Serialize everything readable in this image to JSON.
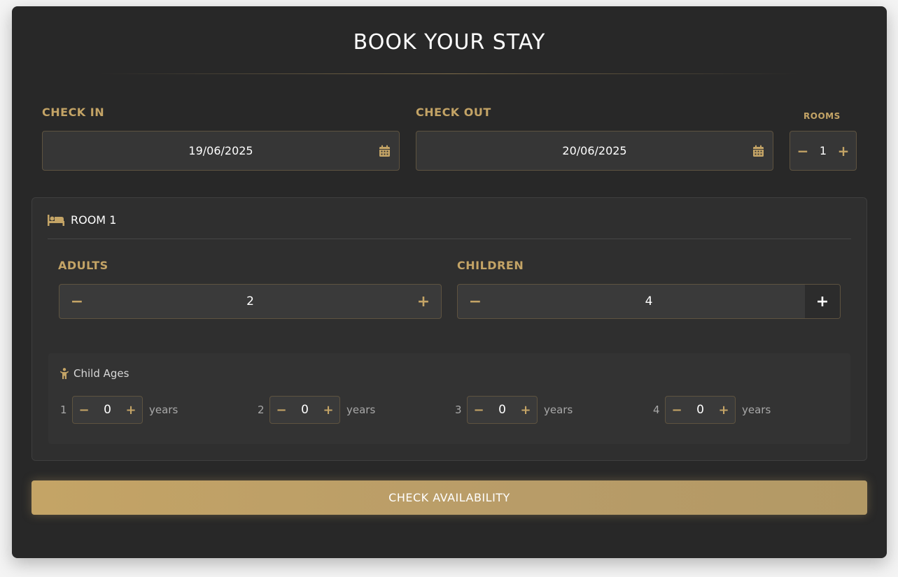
{
  "title": "BOOK YOUR STAY",
  "check_in": {
    "label": "CHECK IN",
    "value": "19/06/2025",
    "icon": "calendar-icon"
  },
  "check_out": {
    "label": "CHECK OUT",
    "value": "20/06/2025",
    "icon": "calendar-icon"
  },
  "rooms": {
    "label": "ROOMS",
    "value": "1",
    "minus": "−",
    "plus": "+"
  },
  "room": {
    "title": "ROOM 1",
    "icon": "bed-icon",
    "adults": {
      "label": "ADULTS",
      "value": "2",
      "minus": "−",
      "plus": "+"
    },
    "children": {
      "label": "CHILDREN",
      "value": "4",
      "minus": "−",
      "plus": "+"
    },
    "child_ages": {
      "label": "Child Ages",
      "icon": "child-icon",
      "unit": "years",
      "items": [
        {
          "index": "1",
          "value": "0"
        },
        {
          "index": "2",
          "value": "0"
        },
        {
          "index": "3",
          "value": "0"
        },
        {
          "index": "4",
          "value": "0"
        }
      ]
    }
  },
  "submit_label": "CHECK AVAILABILITY",
  "colors": {
    "accent": "#c4a466",
    "background": "#282828",
    "panel": "#2f2f2f"
  }
}
